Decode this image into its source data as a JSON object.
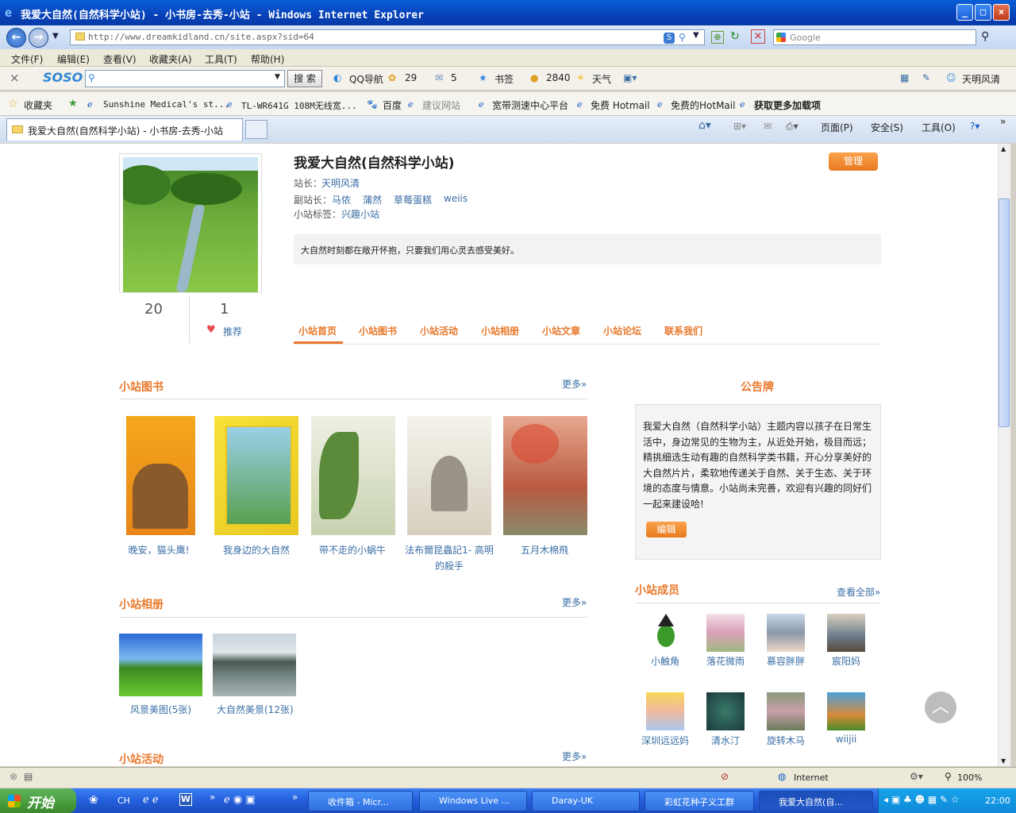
{
  "window": {
    "title": "我爱大自然(自然科学小站) - 小书房-去秀-小站 - Windows Internet Explorer",
    "controls": [
      "_",
      "□",
      "×"
    ]
  },
  "address": {
    "url": "http://www.dreamkidland.cn/site.aspx?sid=64",
    "search_placeholder": "Google"
  },
  "menu": [
    "文件(F)",
    "编辑(E)",
    "查看(V)",
    "收藏夹(A)",
    "工具(T)",
    "帮助(H)"
  ],
  "soso": {
    "logo": "SOSO",
    "search_button": "搜 索",
    "items": [
      "QQ导航",
      "29",
      "5",
      "书签",
      "2840",
      "天气"
    ],
    "user": "天明风清"
  },
  "favorites": {
    "label": "收藏夹",
    "items": [
      "Sunshine Medical's st...",
      "TL-WR641G 108M无线宽...",
      "百度",
      "建议网站",
      "宽带测速中心平台",
      "免费 Hotmail",
      "免费的HotMail",
      "获取更多加载项"
    ]
  },
  "tabs": {
    "active": "我爱大自然(自然科学小站) - 小书房-去秀-小站",
    "tools": [
      "页面(P)",
      "安全(S)",
      "工具(O)"
    ]
  },
  "site": {
    "title": "我爱大自然(自然科学小站)",
    "manage_button": "管理",
    "owner_label": "站长：",
    "owner": "天明风清",
    "deputy_label": "副站长：",
    "deputies": [
      "马侬",
      "蒲然",
      "草莓蛋糕",
      "weiis"
    ],
    "tag_label": "小站标签：",
    "tag": "兴趣小站",
    "motto": "大自然时刻都在敞开怀抱，只要我们用心灵去感受美好。",
    "stat_members": "20",
    "stat_recommend": "1",
    "recommend_label": "推荐"
  },
  "site_nav": [
    "小站首页",
    "小站图书",
    "小站活动",
    "小站相册",
    "小站文章",
    "小站论坛",
    "联系我们"
  ],
  "books_section": {
    "title": "小站图书",
    "more": "更多»",
    "books": [
      {
        "title": "晚安，猫头鹰!",
        "cover_color": "#f0a020"
      },
      {
        "title": "我身边的大自然",
        "cover_color": "#f5d020"
      },
      {
        "title": "带不走的小蜗牛",
        "cover_color": "#cfd8b8"
      },
      {
        "title": "法布爾昆蟲記1- 高明的殺手",
        "cover_color": "#e8e4d8"
      },
      {
        "title": "五月木棉飛",
        "cover_color": "#c86848"
      }
    ]
  },
  "albums_section": {
    "title": "小站相册",
    "more": "更多»",
    "albums": [
      {
        "title": "风景美图(5张)"
      },
      {
        "title": "大自然美景(12张)"
      }
    ]
  },
  "activities_section": {
    "title": "小站活动",
    "more": "更多»"
  },
  "notice": {
    "title": "公告牌",
    "text": "我爱大自然（自然科学小站）主题内容以孩子在日常生活中，身边常见的生物为主，从近处开始，极目而远；精挑细选生动有趣的自然科学类书籍，开心分享美好的大自然片片，柔软地传递关于自然、关于生态、关于环境的态度与情意。小站尚未完善，欢迎有兴趣的同好们一起来建设哈!",
    "edit_button": "编辑"
  },
  "members_section": {
    "title": "小站成员",
    "view_all": "查看全部»",
    "members": [
      "小触角",
      "落花微雨",
      "慕容胖胖",
      "宸阳妈",
      "深圳远远妈",
      "清水汀",
      "旋转木马",
      "wiijii"
    ]
  },
  "statusbar": {
    "zone": "Internet",
    "zoom": "100%"
  },
  "taskbar": {
    "start": "开始",
    "lang": "CH",
    "tasks": [
      "收件箱 - Micr...",
      "Windows Live ...",
      "Daray-UK",
      "彩虹花种子义工群",
      "我爱大自然(自..."
    ],
    "clock": "22:00"
  }
}
